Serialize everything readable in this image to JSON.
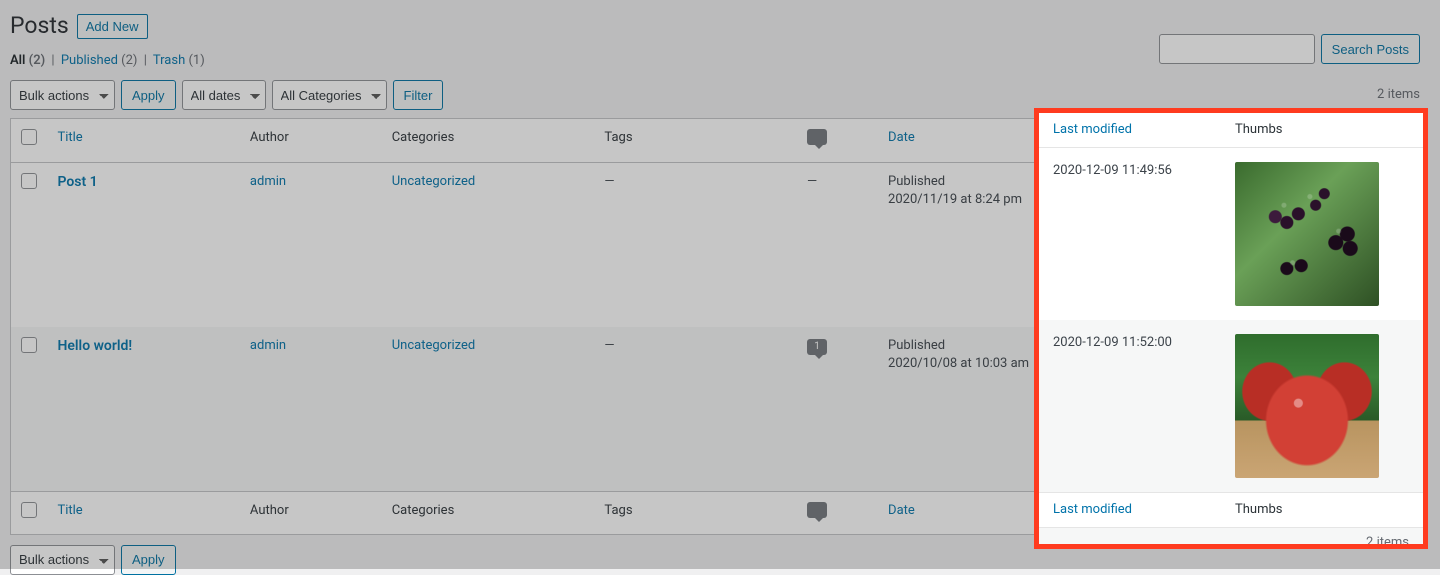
{
  "header": {
    "title": "Posts",
    "add_new": "Add New"
  },
  "filters_links": {
    "all_label": "All",
    "all_count": "(2)",
    "published_label": "Published",
    "published_count": "(2)",
    "trash_label": "Trash",
    "trash_count": "(1)"
  },
  "toolbar": {
    "bulk_actions": "Bulk actions",
    "apply": "Apply",
    "all_dates": "All dates",
    "all_categories": "All Categories",
    "filter": "Filter",
    "items_count": "2 items"
  },
  "search": {
    "placeholder": "",
    "button": "Search Posts"
  },
  "columns": {
    "title": "Title",
    "author": "Author",
    "categories": "Categories",
    "tags": "Tags",
    "date": "Date",
    "last_modified": "Last modified",
    "thumbs": "Thumbs"
  },
  "rows": [
    {
      "title": "Post 1",
      "author": "admin",
      "category": "Uncategorized",
      "tags": "—",
      "comments": "—",
      "date_status": "Published",
      "date_value": "2020/11/19 at 8:24 pm",
      "last_modified": "2020-12-09 11:49:56",
      "thumb_class": "blackberries"
    },
    {
      "title": "Hello world!",
      "author": "admin",
      "category": "Uncategorized",
      "tags": "—",
      "comments": "1",
      "date_status": "Published",
      "date_value": "2020/10/08 at 10:03 am",
      "last_modified": "2020-12-09 11:52:00",
      "thumb_class": "apples"
    }
  ],
  "footer_items": "2 items"
}
